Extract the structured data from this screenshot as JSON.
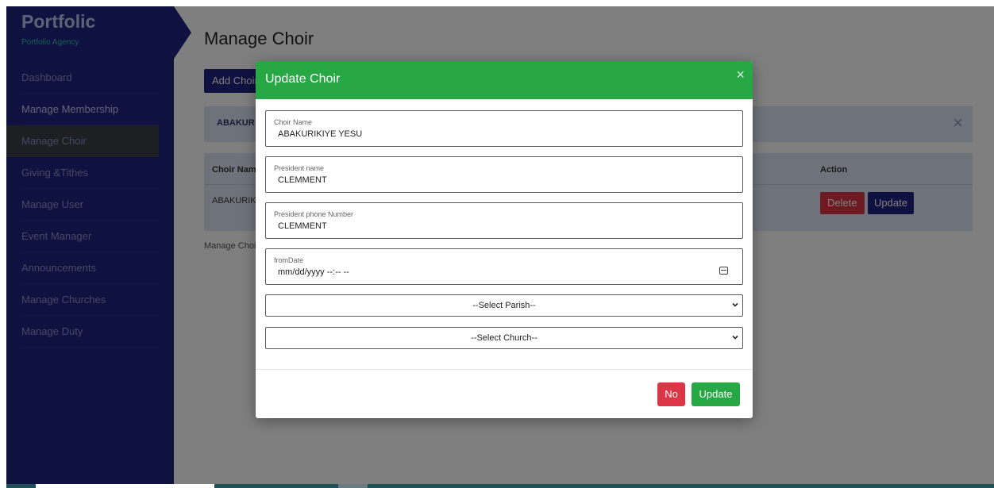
{
  "sidebar": {
    "brand_title": "Portfolic",
    "brand_subtitle": "Portfolio Agency",
    "items": [
      {
        "label": "Dashboard"
      },
      {
        "label": "Manage Membership"
      },
      {
        "label": "Manage Choir"
      },
      {
        "label": "Giving &Tithes"
      },
      {
        "label": "Manage User"
      },
      {
        "label": "Event Manager"
      },
      {
        "label": "Announcements"
      },
      {
        "label": "Manage Churches"
      },
      {
        "label": "Manage Duty"
      }
    ]
  },
  "main": {
    "title": "Manage Choir",
    "add_button": "Add Choir",
    "alert_text": "ABAKUR",
    "alert_close": "×",
    "table": {
      "headers": {
        "name": "Choir Nam",
        "action": "Action"
      },
      "rows": [
        {
          "name": "ABAKURIK",
          "delete_label": "Delete",
          "update_label": "Update"
        }
      ]
    },
    "footer": "Manage Choi"
  },
  "modal": {
    "title": "Update Choir",
    "close_icon": "×",
    "fields": [
      {
        "label": "Choir Name",
        "value": "ABAKURIKIYE YESU"
      },
      {
        "label": "President name",
        "value": "CLEMMENT"
      },
      {
        "label": "President phone Number",
        "value": "CLEMMENT"
      },
      {
        "label": "fromDate",
        "value": "mm/dd/yyyy --:-- --"
      }
    ],
    "selects": [
      {
        "selected": "--Select Parish--"
      },
      {
        "selected": "--Select Church--"
      }
    ],
    "buttons": {
      "no": "No",
      "update": "Update"
    }
  },
  "colors": {
    "sidebar": "#1e2282",
    "modal_header": "#28a745",
    "danger": "#dc3545",
    "primary": "#1e2282"
  }
}
